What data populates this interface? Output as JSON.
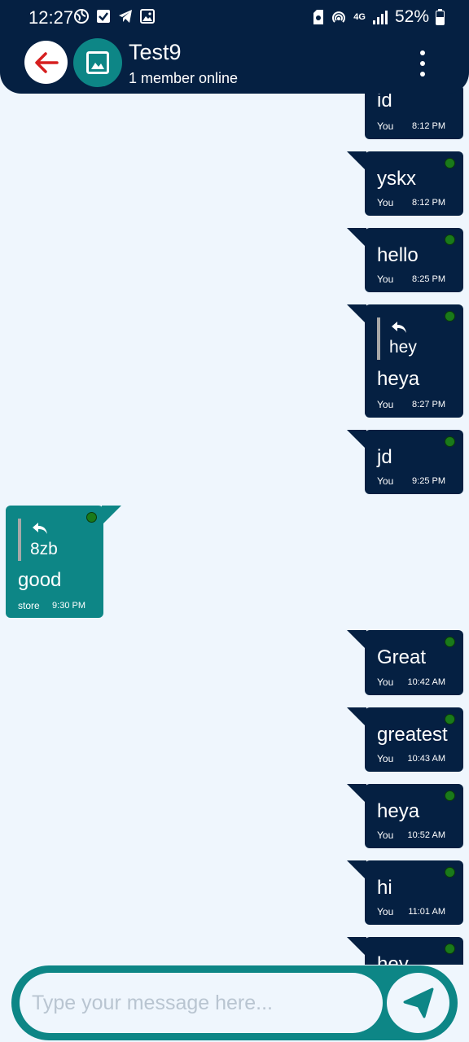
{
  "status_bar": {
    "time": "12:27",
    "battery": "52%",
    "network": "4G"
  },
  "header": {
    "title": "Test9",
    "subtitle": "1 member online"
  },
  "messages": [
    {
      "text": "id",
      "sender": "You",
      "time": "8:12 PM"
    },
    {
      "text": "yskx",
      "sender": "You",
      "time": "8:12 PM"
    },
    {
      "text": "hello",
      "sender": "You",
      "time": "8:25 PM"
    },
    {
      "text": "heya",
      "sender": "You",
      "time": "8:27 PM",
      "reply_to": "hey"
    },
    {
      "text": "jd",
      "sender": "You",
      "time": "9:25 PM"
    },
    {
      "text": "good",
      "sender": "store",
      "time": "9:30 PM",
      "reply_to": "8zb"
    },
    {
      "text": "Great",
      "sender": "You",
      "time": "10:42 AM"
    },
    {
      "text": "greatest",
      "sender": "You",
      "time": "10:43 AM"
    },
    {
      "text": "heya",
      "sender": "You",
      "time": "10:52 AM"
    },
    {
      "text": "hi",
      "sender": "You",
      "time": "11:01 AM"
    },
    {
      "text": "hey",
      "sender": "You",
      "time": ""
    }
  ],
  "composer": {
    "placeholder": "Type your message here..."
  },
  "colors": {
    "header_bg": "#052042",
    "sent_bubble": "#052042",
    "received_bubble": "#0d8686",
    "chat_bg": "#eff6fd",
    "online_dot": "#1a7a1a"
  }
}
